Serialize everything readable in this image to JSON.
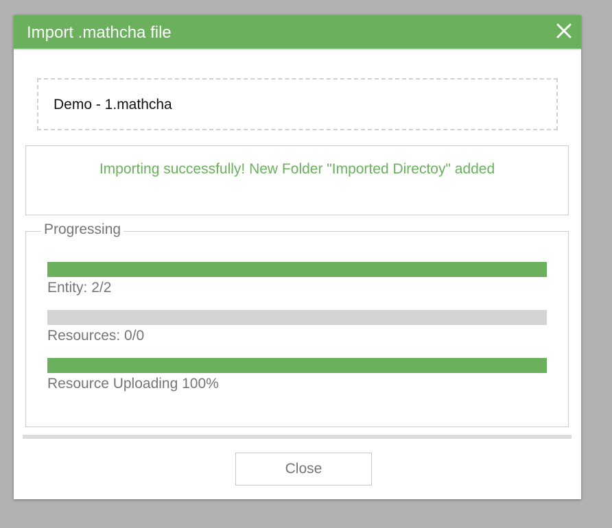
{
  "dialog": {
    "title": "Import .mathcha file",
    "close_icon": "close-x-icon"
  },
  "file": {
    "name": "Demo - 1.mathcha"
  },
  "status": {
    "message": "Importing successfully! New Folder \"Imported Directoy\" added",
    "color": "#6ab05d"
  },
  "progress": {
    "legend": "Progressing",
    "bars": [
      {
        "label": "Entity: 2/2",
        "fraction": 1.0
      },
      {
        "label": "Resources: 0/0",
        "fraction": 0.0
      },
      {
        "label": "Resource Uploading 100%",
        "fraction": 1.0
      }
    ]
  },
  "footer": {
    "close_label": "Close"
  },
  "colors": {
    "accent": "#6ab05d",
    "track": "#d4d4d4",
    "backdrop": "#b2b2b2",
    "muted_text": "#757575"
  }
}
